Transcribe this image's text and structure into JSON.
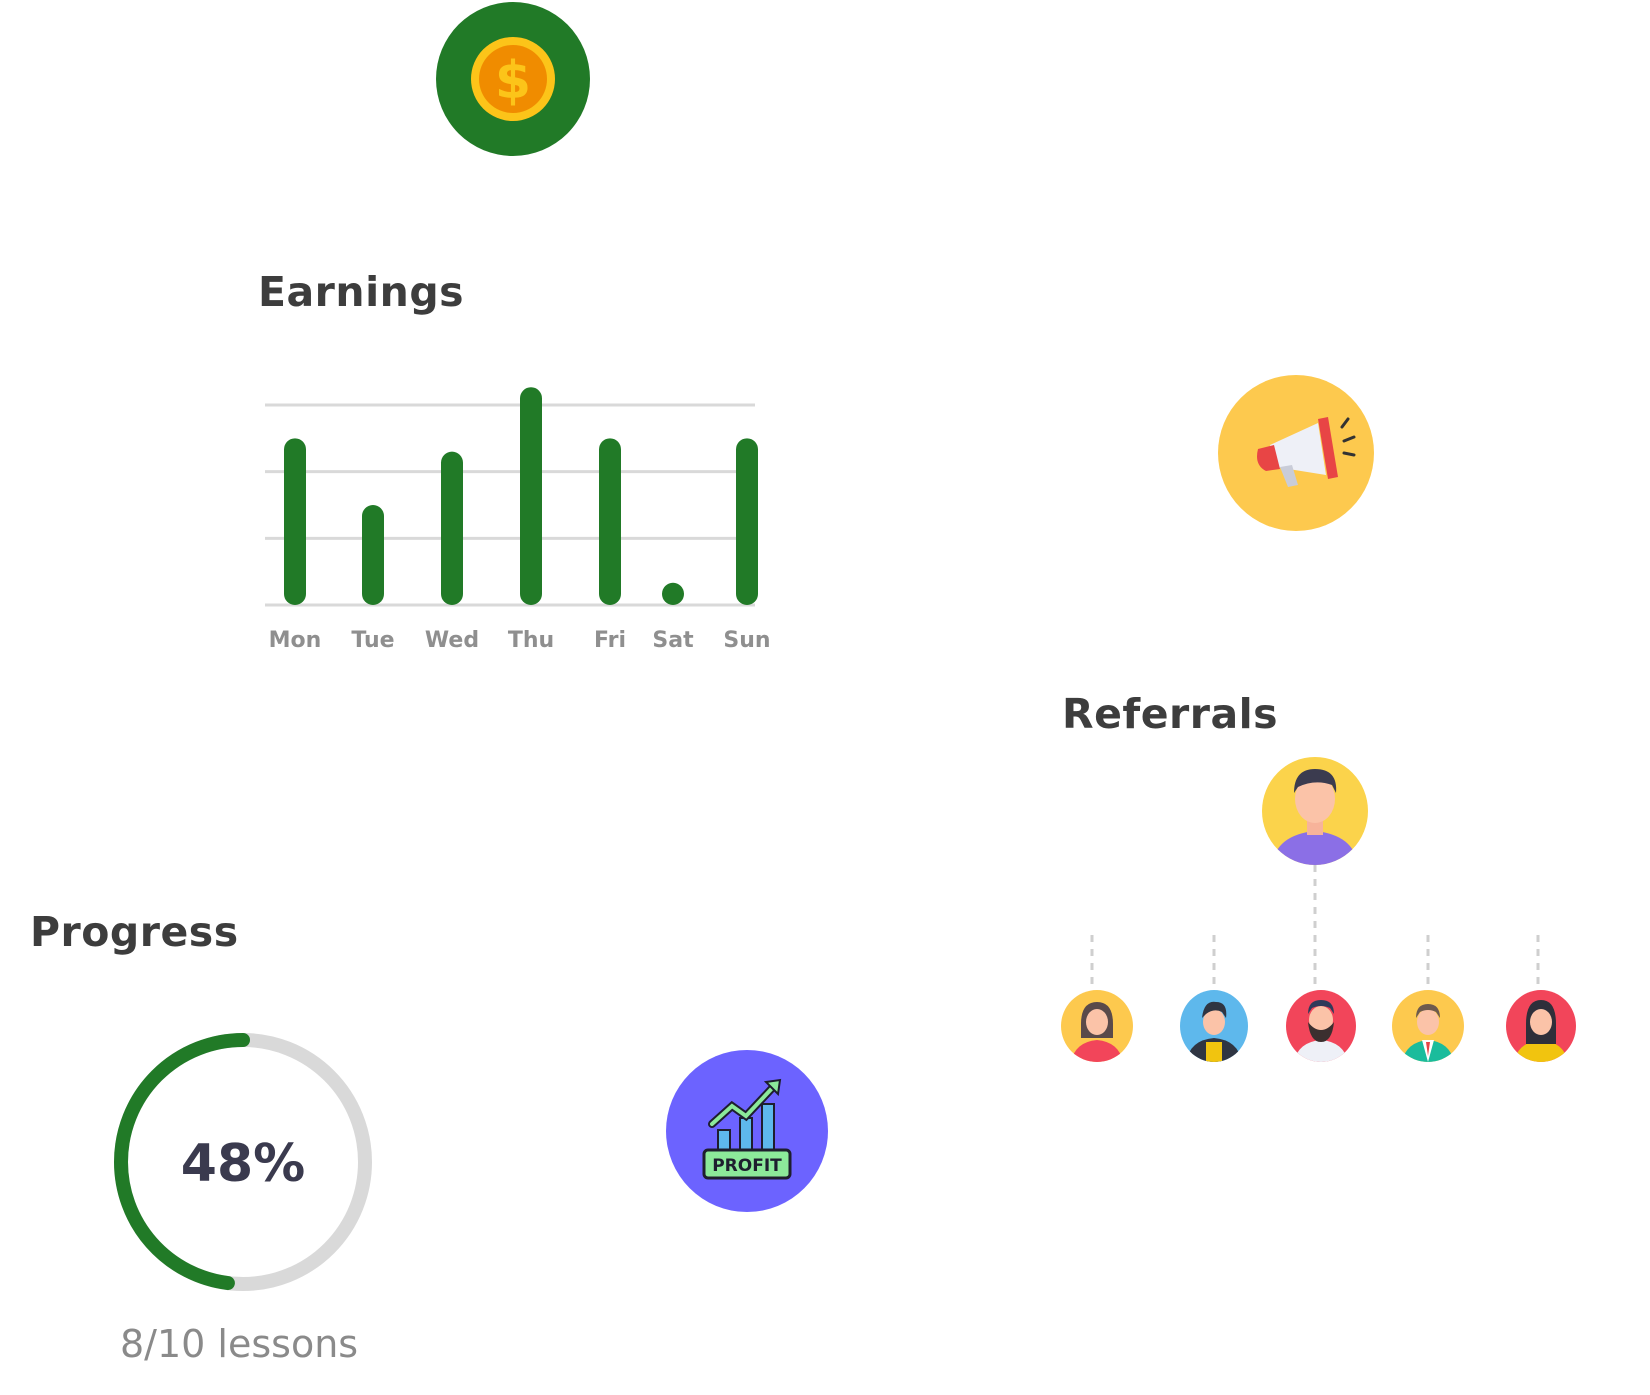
{
  "earnings": {
    "title": "Earnings",
    "icon": "dollar-coin-icon",
    "icon_bg": "#217a27"
  },
  "chart_data": {
    "type": "bar",
    "categories": [
      "Mon",
      "Tue",
      "Wed",
      "Thu",
      "Fri",
      "Sat",
      "Sun"
    ],
    "values": [
      7.5,
      4.5,
      6.9,
      9.8,
      7.5,
      1.0,
      7.5
    ],
    "ylim": [
      0,
      9
    ],
    "grid": true,
    "bar_color": "#217a27",
    "grid_color": "#d9d9d9",
    "title": "",
    "xlabel": "",
    "ylabel": ""
  },
  "referrals": {
    "title": "Referrals",
    "icon": "megaphone-icon",
    "icon_bg": "#fdc94e",
    "root": {
      "icon": "man-avatar-icon",
      "bg": "#fbd34b"
    },
    "children": [
      {
        "icon": "woman-avatar-icon",
        "bg": "#fdc94e"
      },
      {
        "icon": "man-hoodie-avatar-icon",
        "bg": "#5eb8ec"
      },
      {
        "icon": "bearded-man-avatar-icon",
        "bg": "#f2455a"
      },
      {
        "icon": "businessman-avatar-icon",
        "bg": "#fdc94e"
      },
      {
        "icon": "businesswoman-avatar-icon",
        "bg": "#f2455a"
      }
    ]
  },
  "progress": {
    "title": "Progress",
    "percent": 48,
    "percent_label": "48%",
    "lessons_label": "8/10 lessons",
    "ring_color": "#217a27",
    "track_color": "#d9d9d9"
  },
  "profit": {
    "icon": "profit-chart-icon",
    "label": "PROFIT",
    "bg": "#6c63ff"
  }
}
